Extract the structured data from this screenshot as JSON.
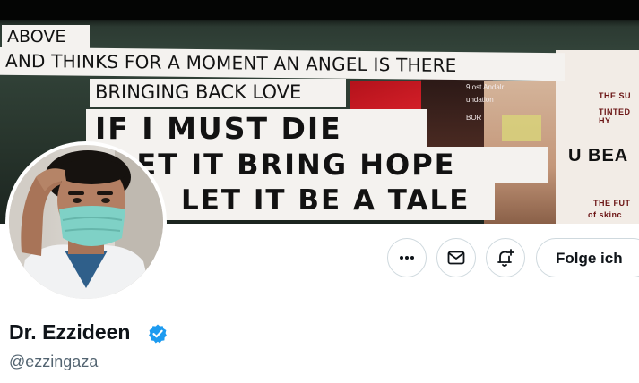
{
  "banner": {
    "lines": [
      "ABOVE",
      "AND THINKS FOR A MOMENT AN ANGEL IS THERE",
      "BRINGING BACK LOVE",
      "IF I MUST DIE",
      "LET IT BRING HOPE",
      "LET IT BE A TALE"
    ],
    "poster_text": [
      "THE SU",
      "TINTED HY",
      "U BEA",
      "THE FUT",
      "of skinc"
    ],
    "poster_mid_text": [
      "9 ost Andalr",
      "undation",
      "BOR"
    ]
  },
  "profile": {
    "display_name": "Dr. Ezzideen",
    "handle": "@ezzingaza",
    "verified": true
  },
  "actions": {
    "more_icon": "more-horizontal-icon",
    "message_icon": "envelope-icon",
    "notify_icon": "bell-plus-icon",
    "follow_label": "Folge ich"
  },
  "colors": {
    "text_primary": "#0f1419",
    "text_secondary": "#536471",
    "button_border": "#cfd9de",
    "verified_blue": "#1d9bf0"
  }
}
